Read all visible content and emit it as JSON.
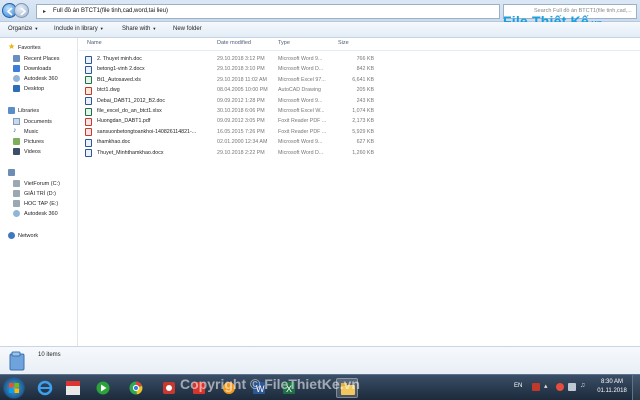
{
  "window": {
    "address_path": "Full đồ án BTCT1(file tinh,cad,word,tai lieu)",
    "search_placeholder": "Search Full đồ án BTCT1(file tinh,cad,...",
    "logo_main": "File Thiết Kế",
    "logo_suffix": ".vn"
  },
  "toolbar": {
    "organize": "Organize",
    "include_in_library": "Include in library",
    "share_with": "Share with",
    "new_folder": "New folder"
  },
  "nav": {
    "favorites": "Favorites",
    "favorites_items": [
      "Recent Places",
      "Downloads",
      "Autodesk 360",
      "Desktop"
    ],
    "libraries": "Libraries",
    "libraries_items": [
      "Documents",
      "Music",
      "Pictures",
      "Videos"
    ],
    "computer_items": [
      "VietForum (C:)",
      "GIẢI TRÍ (D:)",
      "HOC TAP (E:)",
      "Autodesk 360"
    ],
    "network": "Network"
  },
  "columns": {
    "name": "Name",
    "date": "Date modified",
    "type": "Type",
    "size": "Size"
  },
  "files": [
    {
      "name": "2. Thuyet minh.doc",
      "date": "29.10.2018 3:12 PM",
      "type": "Microsoft Word 9...",
      "size": "766 KB",
      "icon": "word-icon"
    },
    {
      "name": "betong1-vinh 2.docx",
      "date": "29.10.2018 3:10 PM",
      "type": "Microsoft Word D...",
      "size": "842 KB",
      "icon": "word-icon"
    },
    {
      "name": "Bt1_Autosaved.xls",
      "date": "29.10.2018 11:02 AM",
      "type": "Microsoft Excel 97...",
      "size": "6,641 KB",
      "icon": "excel-icon"
    },
    {
      "name": "btct1.dwg",
      "date": "08.04.2005 10:00 PM",
      "type": "AutoCAD Drawing",
      "size": "205 KB",
      "icon": "autocad-icon"
    },
    {
      "name": "Debai_DABT1_2012_B2.doc",
      "date": "09.09.2012 1:28 PM",
      "type": "Microsoft Word 9...",
      "size": "243 KB",
      "icon": "word-icon"
    },
    {
      "name": "file_excel_do_an_btct1.xlsx",
      "date": "30.10.2018 6:06 PM",
      "type": "Microsoft Excel W...",
      "size": "1,074 KB",
      "icon": "excel-icon"
    },
    {
      "name": "Huongdan_DABT1.pdf",
      "date": "09.09.2012 3:05 PM",
      "type": "Foxit Reader PDF ...",
      "size": "2,173 KB",
      "icon": "pdf-icon"
    },
    {
      "name": "sansuonbetongtoankhoi-140826114821-...",
      "date": "16.05.2015 7:26 PM",
      "type": "Foxit Reader PDF ...",
      "size": "5,929 KB",
      "icon": "pdf-icon"
    },
    {
      "name": "thamkhao.doc",
      "date": "02.01.2000 12:34 AM",
      "type": "Microsoft Word 9...",
      "size": "627 KB",
      "icon": "word-icon"
    },
    {
      "name": "Thuyet_Minhthamkhao.docx",
      "date": "29.10.2018 2:22 PM",
      "type": "Microsoft Word D...",
      "size": "1,260 KB",
      "icon": "word-icon"
    }
  ],
  "details": {
    "item_count": "10 items"
  },
  "taskbar": {
    "watermark": "Copyright © FileThietKe.vn",
    "language": "EN",
    "time": "8:30 AM",
    "date": "01.11.2018"
  },
  "colors": {
    "accent": "#1aa0e0",
    "taskbar": "#22344a",
    "header_text": "#4a5d7c"
  }
}
